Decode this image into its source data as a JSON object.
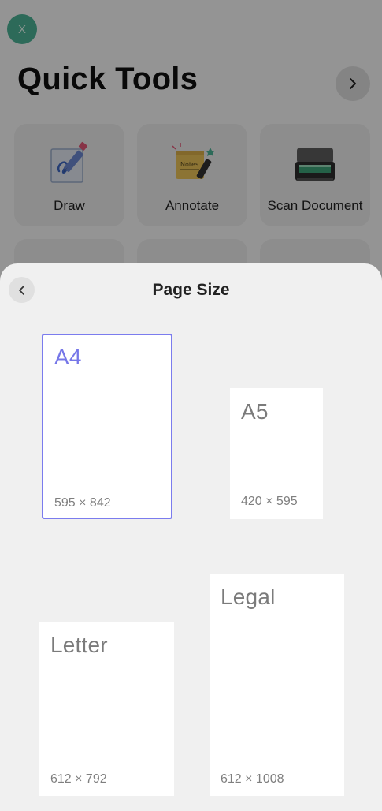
{
  "background": {
    "close_label": "X",
    "title": "Quick Tools",
    "tools": [
      {
        "label": "Draw",
        "icon": "draw-icon"
      },
      {
        "label": "Annotate",
        "icon": "annotate-icon",
        "note_text": "Notes"
      },
      {
        "label": "Scan Document",
        "icon": "scanner-icon"
      }
    ],
    "accent_color": "#4fb79a"
  },
  "sheet": {
    "title": "Page Size",
    "selected_color": "#7b7cee",
    "sizes": [
      {
        "name": "A4",
        "dims": "595 × 842",
        "selected": true
      },
      {
        "name": "A5",
        "dims": "420 × 595",
        "selected": false
      },
      {
        "name": "Letter",
        "dims": "612 × 792",
        "selected": false
      },
      {
        "name": "Legal",
        "dims": "612 × 1008",
        "selected": false
      }
    ]
  }
}
